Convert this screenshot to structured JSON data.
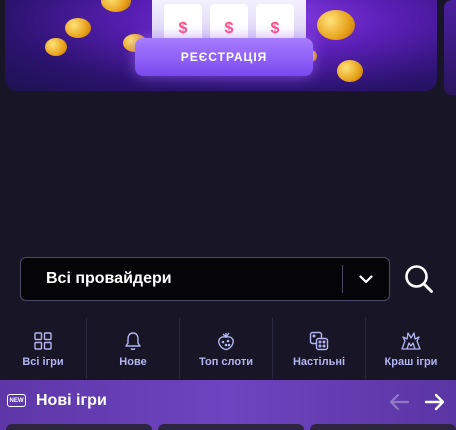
{
  "banner": {
    "register_label": "РЕЄСТРАЦІЯ",
    "reel_symbol": "$"
  },
  "filter": {
    "provider_value": "Всі провайдери"
  },
  "tabs": [
    {
      "label": "Всі ігри",
      "icon": "grid-icon"
    },
    {
      "label": "Нове",
      "icon": "bell-icon"
    },
    {
      "label": "Топ слоти",
      "icon": "strawberry-icon"
    },
    {
      "label": "Настільні",
      "icon": "dice-icon"
    },
    {
      "label": "Краш ігри",
      "icon": "explosion-icon"
    }
  ],
  "new_games": {
    "badge": "NEW",
    "title": "Нові ігри"
  },
  "colors": {
    "background": "#181626",
    "accent": "#7a49ef",
    "tab_text": "#b3b4f2",
    "section_bar": "#6e44c0"
  }
}
